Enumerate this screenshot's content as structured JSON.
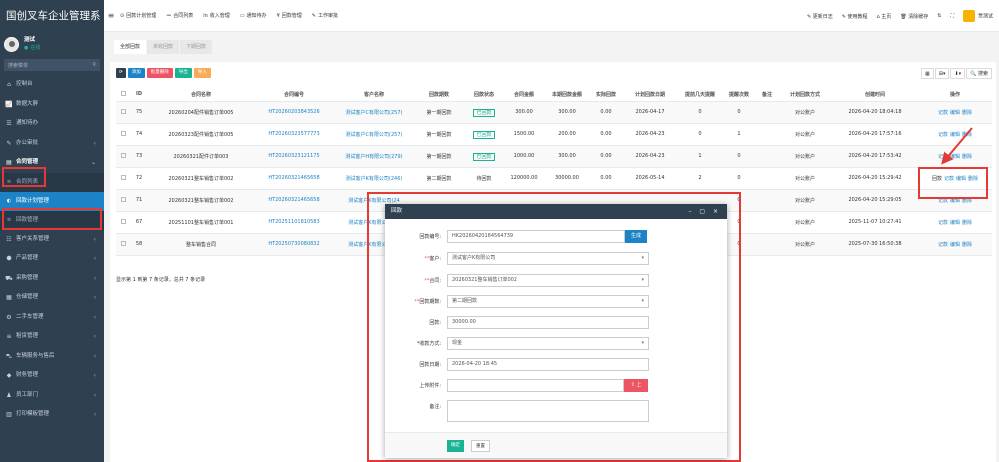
{
  "sidebar": {
    "brand": "国创叉车企业管理系",
    "user_name": "测试",
    "user_status": "在线",
    "search_placeholder": "搜索菜单",
    "items": [
      {
        "icon": "home-icon",
        "glyph": "⌂",
        "label": "控制台",
        "has_arrow": false
      },
      {
        "icon": "chart-icon",
        "glyph": "📈",
        "label": "数据大屏",
        "has_arrow": false
      },
      {
        "icon": "todo-icon",
        "glyph": "☰",
        "label": "通知待办",
        "has_arrow": false
      },
      {
        "icon": "approve-icon",
        "glyph": "✎",
        "label": "办公审批",
        "has_arrow": true
      },
      {
        "icon": "contract-icon",
        "glyph": "▤",
        "label": "合同管理",
        "has_arrow": true
      }
    ],
    "sub_items": [
      {
        "label": "合同列表"
      },
      {
        "label": "回款计划管理"
      },
      {
        "label": "回款管理"
      }
    ],
    "items2": [
      {
        "icon": "customer-icon",
        "glyph": "☷",
        "label": "客户关系管理"
      },
      {
        "icon": "product-icon",
        "glyph": "⬢",
        "label": "产品管理"
      },
      {
        "icon": "purchase-icon",
        "glyph": "⛟",
        "label": "采购管理"
      },
      {
        "icon": "warehouse-icon",
        "glyph": "▦",
        "label": "仓储管理"
      },
      {
        "icon": "secondhand-icon",
        "glyph": "⚙",
        "label": "二手车管理"
      },
      {
        "icon": "rent-icon",
        "glyph": "≡",
        "label": "租赁管理"
      },
      {
        "icon": "service-icon",
        "glyph": "⛍",
        "label": "车辆服务与售后"
      },
      {
        "icon": "finance-icon",
        "glyph": "◆",
        "label": "财务管理"
      },
      {
        "icon": "hr-icon",
        "glyph": "♟",
        "label": "员工部门"
      },
      {
        "icon": "print-icon",
        "glyph": "▥",
        "label": "打印模板管理"
      }
    ]
  },
  "topbar": {
    "menus": [
      {
        "icon": "plan-icon",
        "glyph": "⊙",
        "label": "回款计划管理"
      },
      {
        "icon": "list-icon",
        "glyph": "≔",
        "label": "合同列表"
      },
      {
        "icon": "income-icon",
        "glyph": "in",
        "label": "收入管理"
      },
      {
        "icon": "notice-icon",
        "glyph": "▭",
        "label": "通知待办"
      },
      {
        "icon": "money-icon",
        "glyph": "¥",
        "label": "回款管理"
      },
      {
        "icon": "audit-icon",
        "glyph": "✎",
        "label": "工作审批"
      }
    ],
    "right": [
      {
        "icon": "log-icon",
        "glyph": "✎",
        "label": "更新日志"
      },
      {
        "icon": "tutorial-icon",
        "glyph": "✎",
        "label": "使用教程"
      },
      {
        "icon": "home-icon",
        "glyph": "⌂",
        "label": "主页"
      },
      {
        "icon": "clear-icon",
        "glyph": "🗑",
        "label": "清除缓存"
      },
      {
        "icon": "lock-icon",
        "glyph": "⇅",
        "label": ""
      },
      {
        "icon": "fullscreen-icon",
        "glyph": "⛶",
        "label": ""
      }
    ],
    "user_name": "贾测试"
  },
  "tabs": [
    "全部回款",
    "未收回款",
    "下期回款"
  ],
  "toolbar": {
    "refresh": "⟳",
    "add": "添加",
    "delete": "批量删除",
    "export": "导出",
    "import": "导入"
  },
  "right_tools": [
    "▦",
    "⊞▾",
    "⬇▾",
    "🔍 搜索"
  ],
  "table": {
    "headers": [
      "",
      "ID",
      "合同名称",
      "合同编号",
      "客户名称",
      "回款期数",
      "回款状态",
      "合同金额",
      "本期回款金额",
      "实际回款",
      "计划回款日期",
      "提前几天提醒",
      "提醒次数",
      "备注",
      "计划回款方式",
      "创建时间",
      "操作"
    ],
    "rows": [
      {
        "id": "75",
        "name": "20260204配件销售订单005",
        "no": "HT20260203843526",
        "customer": "测试客户C有限公司(257)",
        "period": "第一期回款",
        "status": "已回款",
        "status_type": "green",
        "amount": "300.00",
        "this_amount": "300.00",
        "actual": "0.00",
        "date": "2026-04-17",
        "remind_days": "0",
        "remind_count": "0",
        "remark": "",
        "method": "对公账户",
        "created": "2026-04-20 18:04:18",
        "ops": [
          "记款",
          "编辑",
          "删除"
        ]
      },
      {
        "id": "74",
        "name": "20260323配件销售订单005",
        "no": "HT20260323577773",
        "customer": "测试客户C有限公司(257)",
        "period": "第一期回款",
        "status": "已回款",
        "status_type": "green",
        "amount": "1500.00",
        "this_amount": "200.00",
        "actual": "0.00",
        "date": "2026-04-23",
        "remind_days": "0",
        "remind_count": "1",
        "remark": "",
        "method": "对公账户",
        "created": "2026-04-20 17:57:16",
        "ops": [
          "记款",
          "编辑",
          "删除"
        ]
      },
      {
        "id": "73",
        "name": "20260321配件订单003",
        "no": "HT20260323121175",
        "customer": "测试客户H有限公司(279)",
        "period": "第一期回款",
        "status": "已回款",
        "status_type": "green",
        "amount": "1000.00",
        "this_amount": "300.00",
        "actual": "0.00",
        "date": "2026-04-23",
        "remind_days": "1",
        "remind_count": "0",
        "remark": "",
        "method": "对公账户",
        "created": "2026-04-20 17:53:42",
        "ops": [
          "记款",
          "编辑",
          "删除"
        ]
      },
      {
        "id": "72",
        "name": "20260321整车销售订单002",
        "no": "HT20260321465658",
        "customer": "测试客户K有限公司(246)",
        "period": "第二期回款",
        "status": "待回款",
        "status_type": "plain",
        "amount": "120000.00",
        "this_amount": "30000.00",
        "actual": "0.00",
        "date": "2026-05-14",
        "remind_days": "2",
        "remind_count": "0",
        "remark": "",
        "method": "对公账户",
        "created": "2026-04-20 15:29:42",
        "ops": [
          "回款",
          "记款",
          "编辑",
          "删除"
        ]
      },
      {
        "id": "71",
        "name": "20260321整车销售订单002",
        "no": "HT20260321465658",
        "customer": "测试客户K有限公司(24",
        "period": "",
        "status": "",
        "status_type": "plain",
        "amount": "",
        "this_amount": "",
        "actual": "",
        "date": "",
        "remind_days": "",
        "remind_count": "0",
        "remark": "",
        "method": "对公账户",
        "created": "2026-04-20 15:29:05",
        "ops": [
          "记款",
          "编辑",
          "删除"
        ]
      },
      {
        "id": "67",
        "name": "20251101整车销售订单001",
        "no": "HT20251101810583",
        "customer": "测试客户K有限公司(24",
        "period": "",
        "status": "",
        "status_type": "plain",
        "amount": "",
        "this_amount": "",
        "actual": "",
        "date": "",
        "remind_days": "",
        "remind_count": "0",
        "remark": "",
        "method": "对公账户",
        "created": "2025-11-07 10:27:41",
        "ops": [
          "记款",
          "编辑",
          "删除"
        ]
      },
      {
        "id": "58",
        "name": "整车销售合同",
        "no": "HT20250730080832",
        "customer": "测试客户K有限公司(23",
        "period": "",
        "status": "",
        "status_type": "plain",
        "amount": "",
        "this_amount": "",
        "actual": "",
        "date": "",
        "remind_days": "",
        "remind_count": "0",
        "remark": "",
        "method": "对公账户",
        "created": "2025-07-30 16:50:38",
        "ops": [
          "记款",
          "编辑",
          "删除"
        ]
      }
    ]
  },
  "pager": "显示第 1 到第 7 条记录，总共 7 条记录",
  "modal": {
    "title": "回款",
    "controls": "– ▢ ×",
    "fields": [
      {
        "label": "回款编号:",
        "required": false,
        "value": "HK20260420184564739",
        "type": "text",
        "button": "生成"
      },
      {
        "label": "客户:",
        "required": true,
        "value": "测试客户K有限公司",
        "type": "select"
      },
      {
        "label": "合同:",
        "required": true,
        "value": "20260321整车销售订单002",
        "type": "select"
      },
      {
        "label": "回款期数:",
        "required": true,
        "value": "第二期回款",
        "type": "select"
      },
      {
        "label": "回款:",
        "required": false,
        "value": "30000.00",
        "type": "text"
      },
      {
        "label": "收款方式:",
        "required": false,
        "prefix": "*",
        "value": "现金",
        "type": "select"
      },
      {
        "label": "回款日期:",
        "required": false,
        "value": "2026-04-20 18:45",
        "type": "text"
      },
      {
        "label": "上传附件:",
        "required": false,
        "value": "",
        "type": "file",
        "button": "⇪ 上传"
      },
      {
        "label": "备注:",
        "required": false,
        "value": "",
        "type": "textarea"
      }
    ],
    "confirm": "确定",
    "reset": "重置"
  },
  "colors": {
    "sidebar_bg": "#2f4050",
    "primary": "#1c84c6",
    "success": "#1ab394",
    "danger": "#ed5565",
    "warning": "#f8ac59",
    "highlight": "#e53935"
  }
}
